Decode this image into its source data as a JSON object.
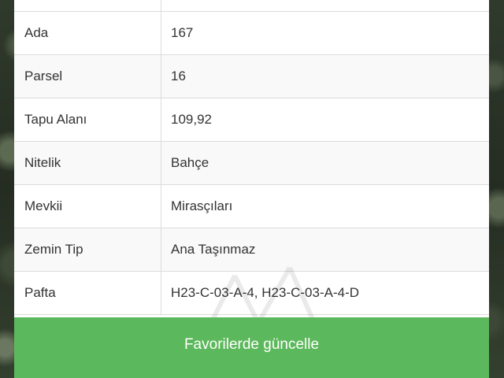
{
  "table": {
    "rows": [
      {
        "label": "",
        "value": ""
      },
      {
        "label": "Ada",
        "value": "167"
      },
      {
        "label": "Parsel",
        "value": "16"
      },
      {
        "label": "Tapu Alanı",
        "value": "109,92"
      },
      {
        "label": "Nitelik",
        "value": "Bahçe"
      },
      {
        "label": "Mevkii",
        "value": "Mirasçıları"
      },
      {
        "label": "Zemin Tip",
        "value": "Ana Taşınmaz"
      },
      {
        "label": "Pafta",
        "value": "H23-C-03-A-4, H23-C-03-A-4-D"
      }
    ]
  },
  "action": {
    "label": "Favorilerde güncelle",
    "color": "#5cb85c"
  }
}
